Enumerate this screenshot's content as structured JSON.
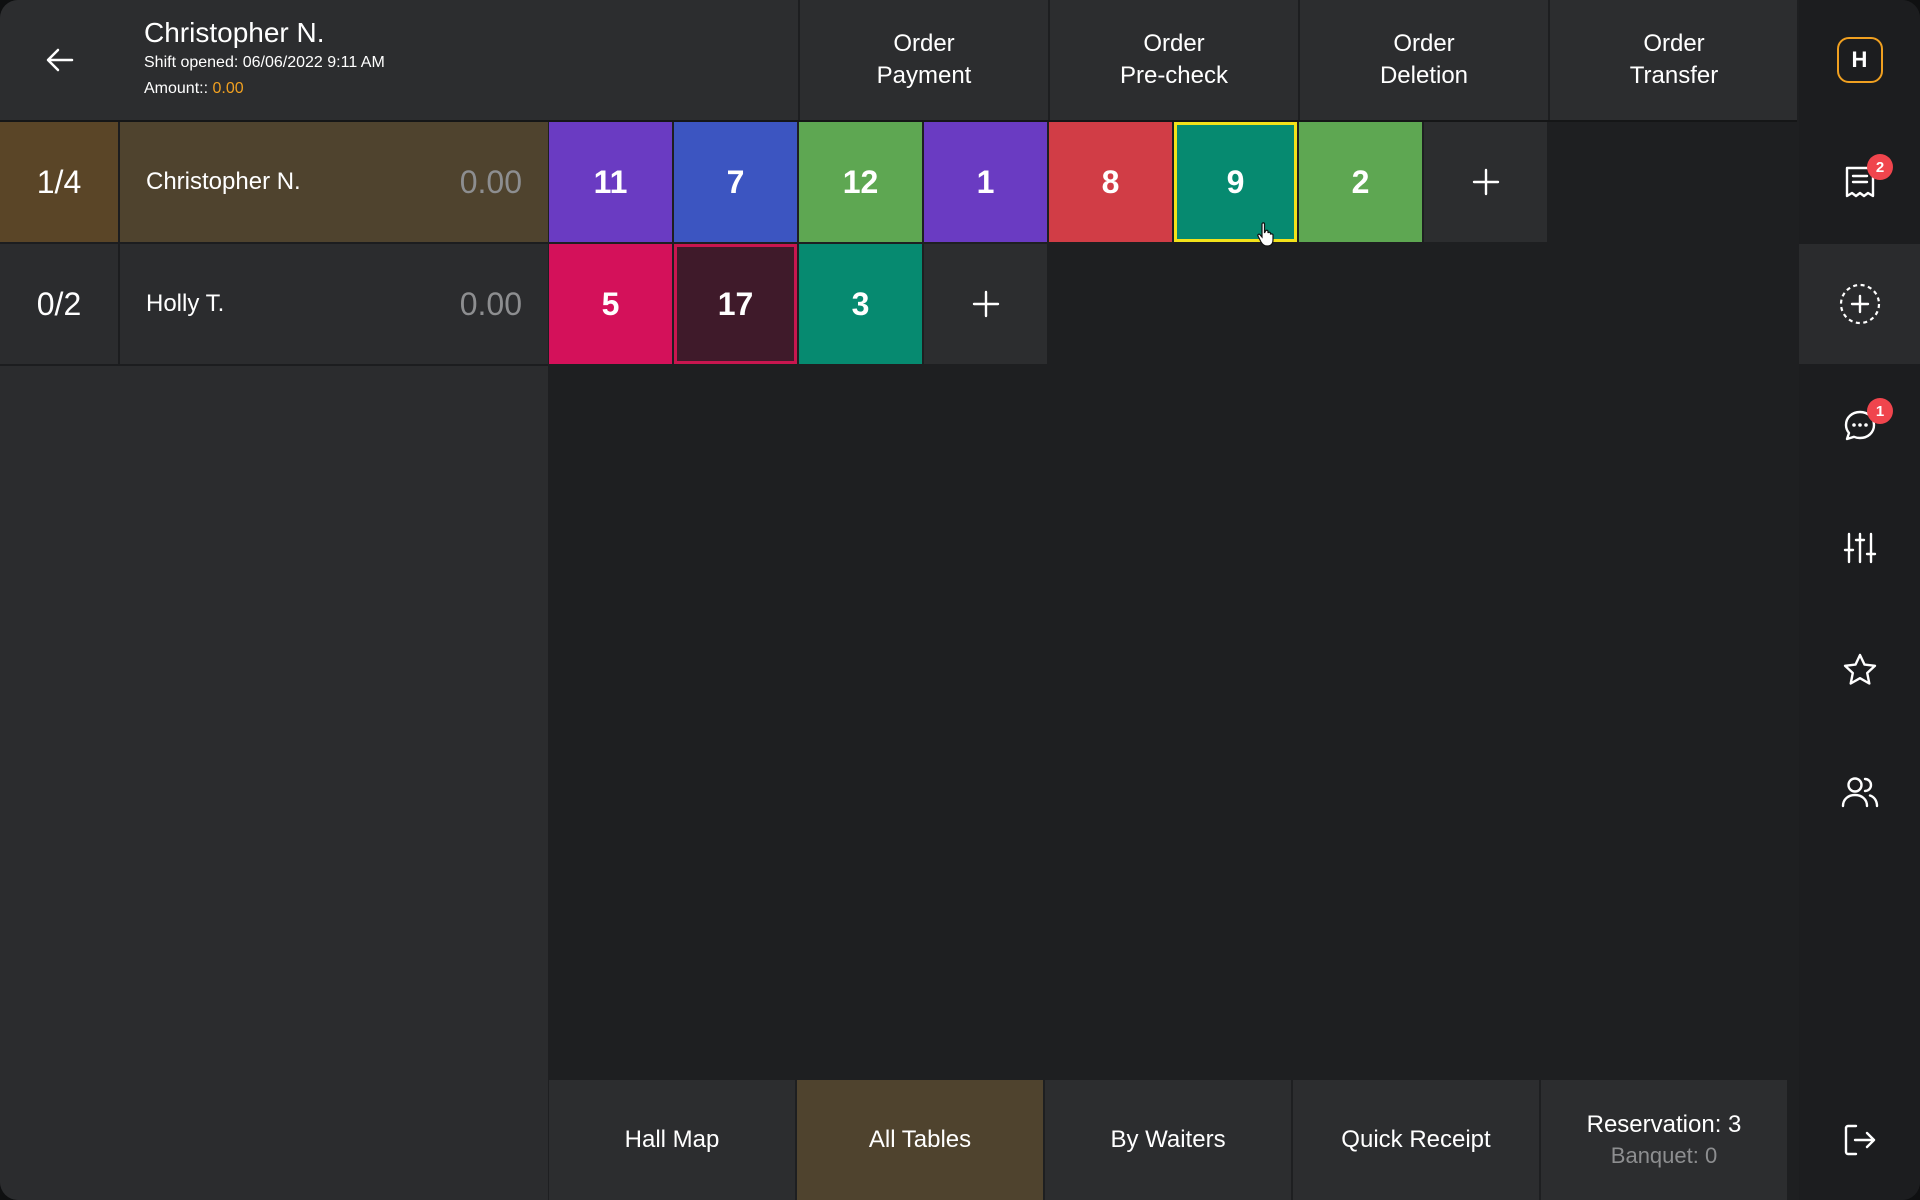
{
  "header": {
    "user_name": "Christopher N.",
    "shift_label": "Shift opened:",
    "shift_value": "06/06/2022 9:11 AM",
    "amount_label": "Amount::",
    "amount_value": "0.00",
    "amount_color": "#f0a020"
  },
  "order_actions": [
    {
      "line1": "Order",
      "line2": "Payment"
    },
    {
      "line1": "Order",
      "line2": "Pre-check"
    },
    {
      "line1": "Order",
      "line2": "Deletion"
    },
    {
      "line1": "Order",
      "line2": "Transfer"
    }
  ],
  "waiters": [
    {
      "count": "1/4",
      "name": "Christopher N.",
      "amount": "0.00",
      "active": true
    },
    {
      "count": "0/2",
      "name": "Holly T.",
      "amount": "0.00",
      "active": false
    }
  ],
  "tables": [
    [
      {
        "label": "11",
        "color": "#6a3bc2"
      },
      {
        "label": "7",
        "color": "#3c55c1"
      },
      {
        "label": "12",
        "color": "#5ea752"
      },
      {
        "label": "1",
        "color": "#6a3bc2"
      },
      {
        "label": "8",
        "color": "#d13d46"
      },
      {
        "label": "9",
        "color": "#068a70",
        "selected": true
      },
      {
        "label": "2",
        "color": "#5ea752"
      },
      {
        "label": "+",
        "plus": true
      }
    ],
    [
      {
        "label": "5",
        "color": "#d4115a"
      },
      {
        "label": "17",
        "color": "#3f1a2a",
        "outlined": true
      },
      {
        "label": "3",
        "color": "#068a70"
      },
      {
        "label": "+",
        "plus": true
      }
    ]
  ],
  "bottom_tabs": {
    "hall_map": "Hall Map",
    "all_tables": "All Tables",
    "by_waiters": "By Waiters",
    "quick_receipt": "Quick Receipt",
    "reservation": "Reservation: 3",
    "banquet": "Banquet: 0"
  },
  "sidebar": {
    "logo_letter": "H",
    "receipts_badge": "2",
    "messages_badge": "1"
  },
  "colors": {
    "accent": "#f0a020",
    "active_bg": "#4f432e",
    "selected_border": "#f3e21a",
    "badge": "#f0454d"
  }
}
